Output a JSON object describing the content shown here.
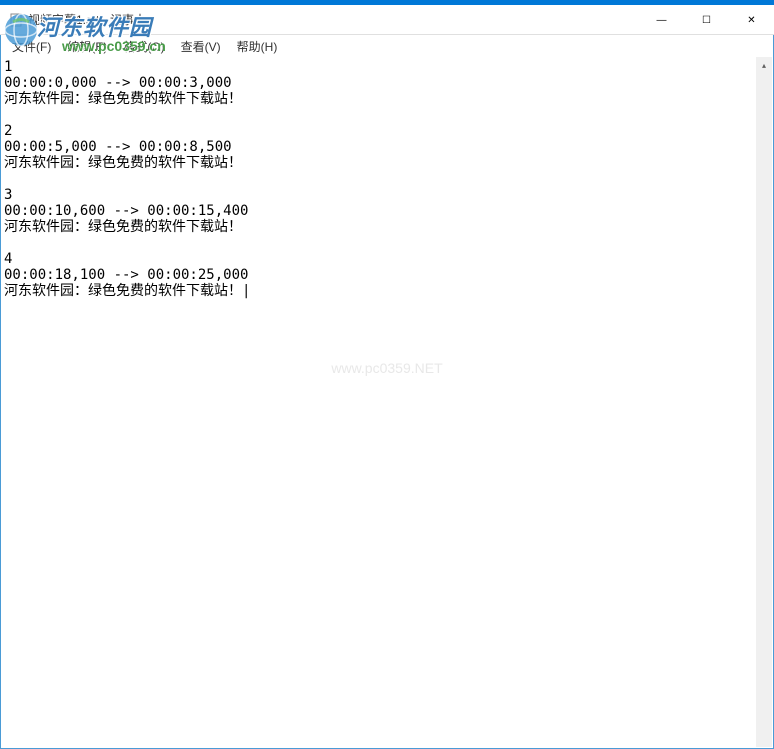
{
  "window": {
    "title": "视频字幕1.srt - 记事本"
  },
  "menubar": {
    "file": "文件(F)",
    "edit": "编辑(E)",
    "format": "格式(O)",
    "view": "查看(V)",
    "help": "帮助(H)"
  },
  "content": {
    "text": "1\n00:00:0,000 --> 00:00:3,000\n河东软件园：绿色免费的软件下载站！\n\n2\n00:00:5,000 --> 00:00:8,500\n河东软件园：绿色免费的软件下载站！\n\n3\n00:00:10,600 --> 00:00:15,400\n河东软件园：绿色免费的软件下载站！\n\n4\n00:00:18,100 --> 00:00:25,000\n河东软件园：绿色免费的软件下载站！|"
  },
  "watermark": {
    "logo_text": "河东软件园",
    "logo_url": "www.pc0359.cn",
    "center_text": "www.pc0359.NET"
  },
  "window_controls": {
    "minimize": "—",
    "maximize": "☐",
    "close": "✕"
  },
  "scrollbar": {
    "up": "▴",
    "down": "▾"
  }
}
